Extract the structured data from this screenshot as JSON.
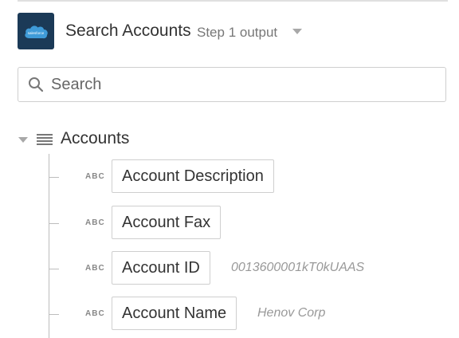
{
  "header": {
    "app_logo_text": "salesforce",
    "title": "Search Accounts",
    "step_label": "Step 1 output"
  },
  "search": {
    "placeholder": "Search"
  },
  "tree": {
    "root_label": "Accounts",
    "fields": [
      {
        "type": "ABC",
        "label": "Account Description",
        "value": ""
      },
      {
        "type": "ABC",
        "label": "Account Fax",
        "value": ""
      },
      {
        "type": "ABC",
        "label": "Account ID",
        "value": "0013600001kT0kUAAS"
      },
      {
        "type": "ABC",
        "label": "Account Name",
        "value": "Henov Corp"
      }
    ]
  },
  "colors": {
    "logo_background": "#1b3a57",
    "logo_cloud": "#3f9bd8"
  }
}
